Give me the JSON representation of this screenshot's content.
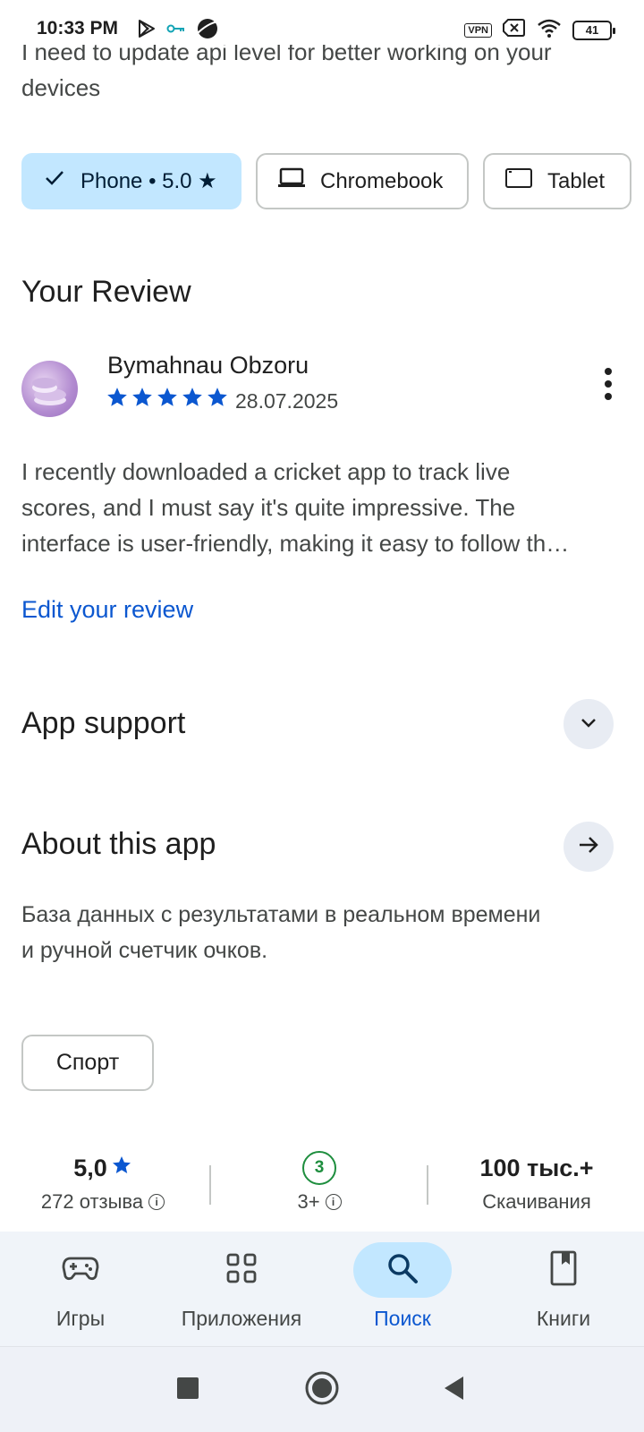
{
  "status_bar": {
    "time": "10:33 PM",
    "vpn": "VPN",
    "battery": "41",
    "left_icons": [
      "play-store-icon",
      "key-icon",
      "planet-icon"
    ],
    "right_icons": [
      "vpn-icon",
      "no-sim-icon",
      "wifi-icon",
      "battery-icon"
    ]
  },
  "previous_review_text": "I need to update api level for better working on your devices",
  "device_chips": [
    {
      "label": "Phone • 5.0 ★",
      "selected": true,
      "icon": "check-icon"
    },
    {
      "label": "Chromebook",
      "selected": false,
      "icon": "laptop-icon"
    },
    {
      "label": "Tablet",
      "selected": false,
      "icon": "tablet-icon"
    }
  ],
  "your_review": {
    "section_title": "Your Review",
    "reviewer_name": "Bymahnau Obzoru",
    "rating": 5,
    "date": "28.07.2025",
    "body": "I recently downloaded a cricket app to track live scores, and I must say it's quite impressive. The interface is user-friendly, making it easy to follow th…",
    "body_lines": [
      "I recently downloaded a cricket app to track live",
      "scores, and I must say it's quite impressive. The",
      "interface is user-friendly, making it easy to follow th…"
    ],
    "edit_link": "Edit your review"
  },
  "app_support": {
    "title": "App support"
  },
  "about": {
    "title": "About this app",
    "description": "База данных с результатами в реальном времени и ручной счетчик очков.",
    "description_lines": [
      "База данных с результатами в реальном времени",
      "и ручной счетчик очков."
    ],
    "category": "Спорт"
  },
  "stats": {
    "rating_value": "5,0",
    "rating_label": "272 отзыва",
    "age_badge": "3",
    "age_label": "3+",
    "downloads_value": "100 тыс.+",
    "downloads_label": "Скачивания"
  },
  "bottom_nav": [
    {
      "label": "Игры",
      "icon": "gamepad-icon",
      "active": false
    },
    {
      "label": "Приложения",
      "icon": "apps-grid-icon",
      "active": false
    },
    {
      "label": "Поиск",
      "icon": "search-icon",
      "active": true
    },
    {
      "label": "Книги",
      "icon": "book-icon",
      "active": false
    }
  ],
  "colors": {
    "accent_blue": "#0b57d0",
    "chip_selected_bg": "#c2e7ff",
    "star_blue": "#0b57d0",
    "age_green": "#1e8e3e",
    "nav_bg": "#f0f4f9"
  }
}
